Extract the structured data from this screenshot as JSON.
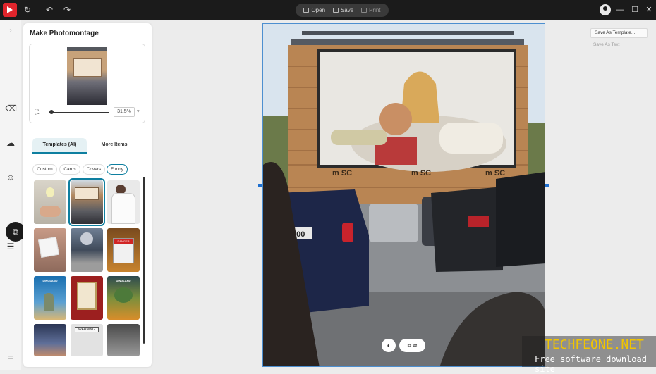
{
  "window": {
    "toolbar": {
      "open_label": "Open",
      "save_label": "Save",
      "print_label": "Print"
    }
  },
  "panel": {
    "title": "Make Photomontage",
    "zoom_value": "31.5%",
    "tabs": [
      {
        "label": "Templates (AI)",
        "active": true
      },
      {
        "label": "More Items",
        "active": false
      }
    ],
    "filters": [
      {
        "label": "Custom",
        "selected": false
      },
      {
        "label": "Cards",
        "selected": false
      },
      {
        "label": "Covers",
        "selected": false
      },
      {
        "label": "Funny",
        "selected": true
      }
    ],
    "templates": {
      "tile_8_text": "DANGER",
      "tile_9_text": "DINGLAND",
      "tile_11_text": "DINGLAND",
      "tile_14_text": "WARNING"
    }
  },
  "right_panel": {
    "save_template_label": "Save As Template...",
    "save_text_label": "Save As Text"
  },
  "photo": {
    "car_plate": "900",
    "container_text_1": "m\nSC",
    "container_text_2": "m\nSC",
    "container_text_3": "m\nSC"
  },
  "watermark": {
    "title": "TECHFEONE.NET",
    "subtitle": "Free software download site"
  },
  "colors": {
    "accent": "#0e7fa0",
    "brand": "#e0252c",
    "selection": "#1e6fd0"
  }
}
